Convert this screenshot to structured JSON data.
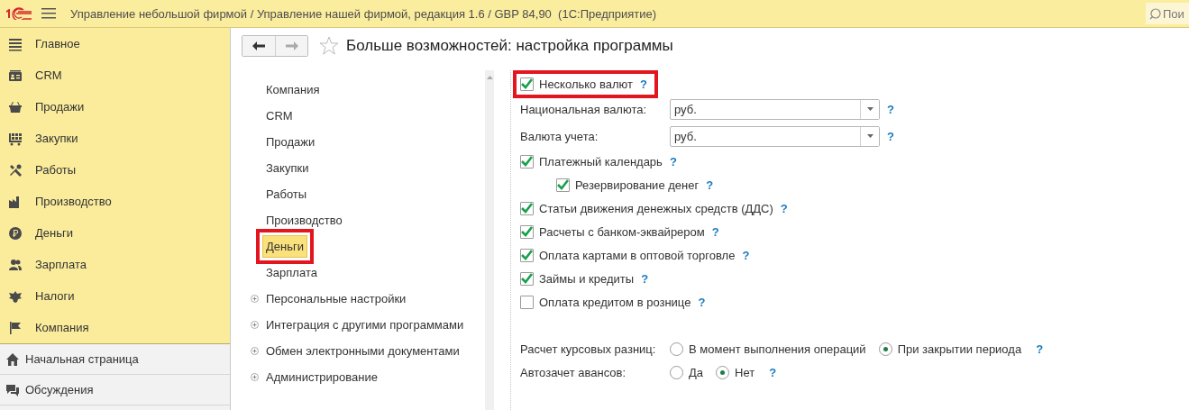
{
  "app_bar": {
    "title": "Управление небольшой фирмой / Управление нашей фирмой, редакция 1.6 / GBP 84,90  (1С:Предприятие)",
    "search_placeholder": "Пои"
  },
  "sections": [
    {
      "label": "Главное"
    },
    {
      "label": "CRM"
    },
    {
      "label": "Продажи"
    },
    {
      "label": "Закупки"
    },
    {
      "label": "Работы"
    },
    {
      "label": "Производство"
    },
    {
      "label": "Деньги"
    },
    {
      "label": "Зарплата"
    },
    {
      "label": "Налоги"
    },
    {
      "label": "Компания"
    }
  ],
  "bottom_links": [
    {
      "label": "Начальная страница"
    },
    {
      "label": "Обсуждения"
    }
  ],
  "page": {
    "title": "Больше возможностей: настройка программы",
    "nav_items": [
      {
        "label": "Компания",
        "selected": false,
        "expandable": false,
        "highlighted": false
      },
      {
        "label": "CRM",
        "selected": false,
        "expandable": false,
        "highlighted": false
      },
      {
        "label": "Продажи",
        "selected": false,
        "expandable": false,
        "highlighted": false
      },
      {
        "label": "Закупки",
        "selected": false,
        "expandable": false,
        "highlighted": false
      },
      {
        "label": "Работы",
        "selected": false,
        "expandable": false,
        "highlighted": false
      },
      {
        "label": "Производство",
        "selected": false,
        "expandable": false,
        "highlighted": false
      },
      {
        "label": "Деньги",
        "selected": true,
        "expandable": false,
        "highlighted": true
      },
      {
        "label": "Зарплата",
        "selected": false,
        "expandable": false,
        "highlighted": false
      },
      {
        "label": "Персональные настройки",
        "selected": false,
        "expandable": true,
        "highlighted": false
      },
      {
        "label": "Интеграция с другими программами",
        "selected": false,
        "expandable": true,
        "highlighted": false
      },
      {
        "label": "Обмен электронными документами",
        "selected": false,
        "expandable": true,
        "highlighted": false
      },
      {
        "label": "Администрирование",
        "selected": false,
        "expandable": true,
        "highlighted": false
      }
    ],
    "settings": [
      {
        "kind": "checkbox",
        "label": "Несколько валют",
        "checked": true,
        "help": "?",
        "highlighted": true
      },
      {
        "kind": "select",
        "label": "Национальная валюта:",
        "value": "руб.",
        "help": "?"
      },
      {
        "kind": "select",
        "label": "Валюта учета:",
        "value": "руб.",
        "help": "?"
      },
      {
        "kind": "checkbox",
        "label": "Платежный календарь",
        "checked": true,
        "help": "?",
        "children": [
          {
            "kind": "checkbox",
            "label": "Резервирование денег",
            "checked": true,
            "help": "?"
          }
        ]
      },
      {
        "kind": "checkbox",
        "label": "Статьи движения денежных средств (ДДС)",
        "checked": true,
        "help": "?"
      },
      {
        "kind": "checkbox",
        "label": "Расчеты с банком-эквайрером",
        "checked": true,
        "help": "?"
      },
      {
        "kind": "checkbox",
        "label": "Оплата картами в оптовой торговле",
        "checked": true,
        "help": "?"
      },
      {
        "kind": "checkbox",
        "label": "Займы и кредиты",
        "checked": true,
        "help": "?"
      },
      {
        "kind": "checkbox",
        "label": "Оплата кредитом в рознице",
        "checked": false,
        "help": "?"
      }
    ],
    "radio_groups": [
      {
        "label": "Расчет курсовых разниц:",
        "options": [
          {
            "label": "В момент выполнения операций",
            "selected": false
          },
          {
            "label": "При закрытии периода",
            "selected": true
          }
        ],
        "help": "?"
      },
      {
        "label": "Автозачет авансов:",
        "options": [
          {
            "label": "Да",
            "selected": false
          },
          {
            "label": "Нет",
            "selected": true
          }
        ],
        "help": "?"
      }
    ]
  }
}
